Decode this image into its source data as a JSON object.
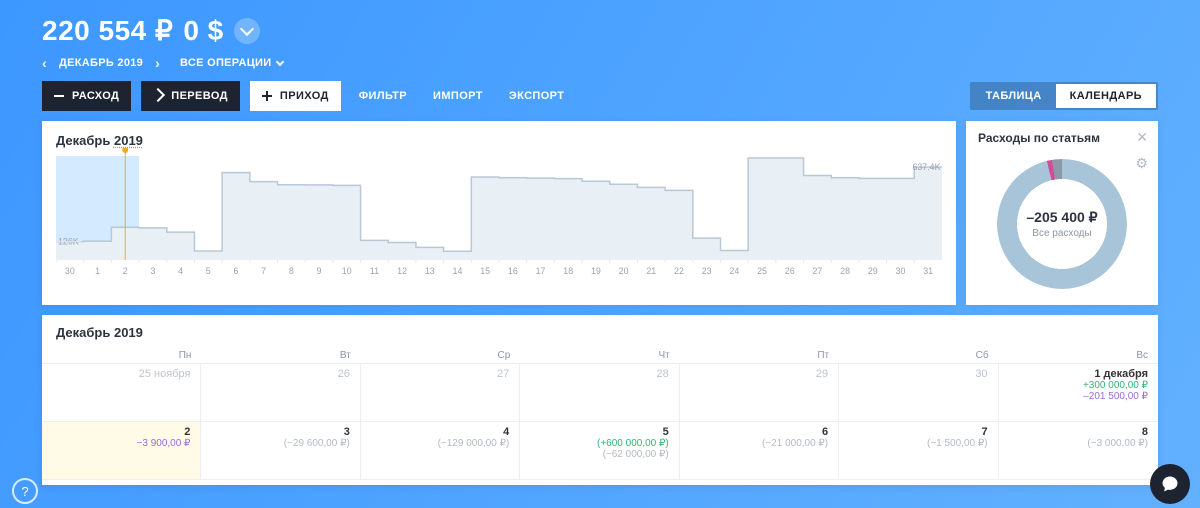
{
  "balances": {
    "rub": "220 554 ₽",
    "usd": "0 $"
  },
  "period": {
    "label": "ДЕКАБРЬ 2019",
    "ops_label": "ВСЕ ОПЕРАЦИИ"
  },
  "toolbar": {
    "expense": "РАСХОД",
    "transfer": "ПЕРЕВОД",
    "income": "ПРИХОД",
    "filter": "ФИЛЬТР",
    "import": "ИМПОРТ",
    "export": "ЭКСПОРТ",
    "view_table": "ТАБЛИЦА",
    "view_calendar": "КАЛЕНДАРЬ"
  },
  "chart": {
    "title_prefix": "Декабрь",
    "title_year": "2019",
    "y_start_label": "126K",
    "y_end_label": "637.4K"
  },
  "side": {
    "title": "Расходы по статьям",
    "total": "–205 400 ₽",
    "subtitle": "Все расходы"
  },
  "calendar": {
    "title": "Декабрь 2019",
    "weekdays": [
      "Пн",
      "Вт",
      "Ср",
      "Чт",
      "Пт",
      "Сб",
      "Вс"
    ],
    "rows": [
      [
        {
          "label": "25 ноября",
          "muted": true
        },
        {
          "label": "26",
          "muted": true
        },
        {
          "label": "27",
          "muted": true
        },
        {
          "label": "28",
          "muted": true
        },
        {
          "label": "29",
          "muted": true
        },
        {
          "label": "30",
          "muted": true
        },
        {
          "label": "1 декабря",
          "income": "+300 000,00 ₽",
          "expense": "–201 500,00 ₽"
        }
      ],
      [
        {
          "label": "2",
          "today": true,
          "expense": "−3 900,00 ₽"
        },
        {
          "label": "3",
          "sub": "(−29 600,00 ₽)"
        },
        {
          "label": "4",
          "sub": "(−129 000,00 ₽)"
        },
        {
          "label": "5",
          "income": "(+600 000,00 ₽)",
          "sub": "(−62 000,00 ₽)"
        },
        {
          "label": "6",
          "sub": "(−21 000,00 ₽)"
        },
        {
          "label": "7",
          "sub": "(−1 500,00 ₽)"
        },
        {
          "label": "8",
          "sub": "(−3 000,00 ₽)"
        }
      ]
    ]
  },
  "chart_data": {
    "type": "area-step",
    "title": "Декабрь 2019",
    "xlabel": "",
    "ylabel": "",
    "x_start": 30,
    "x_end": 31,
    "x_ticks": [
      30,
      1,
      2,
      3,
      4,
      5,
      6,
      7,
      8,
      9,
      10,
      11,
      12,
      13,
      14,
      15,
      16,
      17,
      18,
      19,
      20,
      21,
      22,
      23,
      24,
      25,
      26,
      27,
      28,
      29,
      30,
      31
    ],
    "marker_day": 2,
    "annotations": {
      "start_value_k": 126,
      "end_value_k": 637.4
    },
    "series": [
      {
        "name": "balance",
        "unit": "K RUB",
        "days": [
          30,
          1,
          2,
          3,
          4,
          5,
          6,
          7,
          8,
          9,
          10,
          11,
          12,
          13,
          14,
          15,
          16,
          17,
          18,
          19,
          20,
          21,
          22,
          23,
          24,
          25,
          26,
          27,
          28,
          29,
          30,
          31
        ],
        "values_k": [
          126,
          130,
          224.5,
          220.6,
          191,
          62,
          600,
          538,
          517,
          515.5,
          512.5,
          135,
          120,
          87,
          60,
          570,
          565,
          562,
          559,
          541,
          520,
          499,
          478,
          150,
          65,
          700,
          700,
          580,
          565,
          560,
          560,
          637.4
        ]
      }
    ]
  }
}
